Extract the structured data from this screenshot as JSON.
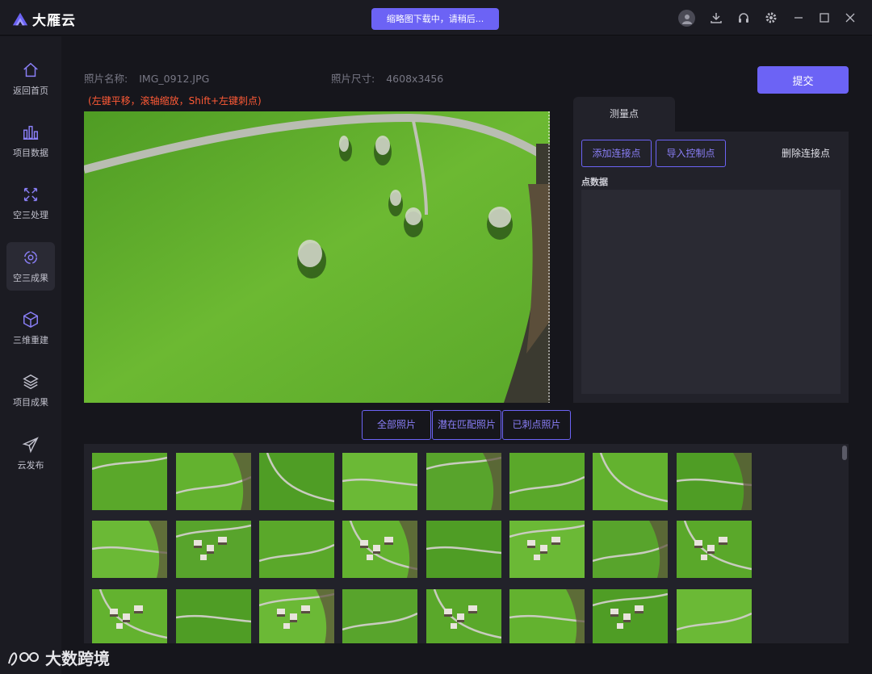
{
  "app": {
    "name": "大雁云",
    "toast": "缩略图下载中，请稍后..."
  },
  "sidebar": {
    "items": [
      {
        "label": "返回首页",
        "icon": "home-icon"
      },
      {
        "label": "项目数据",
        "icon": "bar-chart-icon"
      },
      {
        "label": "空三处理",
        "icon": "cross-arrows-icon"
      },
      {
        "label": "空三成果",
        "icon": "target-icon",
        "active": true
      },
      {
        "label": "三维重建",
        "icon": "cube-icon"
      },
      {
        "label": "项目成果",
        "icon": "layers-icon"
      },
      {
        "label": "云发布",
        "icon": "send-icon"
      }
    ]
  },
  "photo": {
    "name_label": "照片名称:",
    "name_value": "IMG_0912.JPG",
    "size_label": "照片尺寸:",
    "size_value": "4608x3456",
    "hint": "(左键平移，滚轴缩放，Shift+左键刺点)"
  },
  "submit_label": "提交",
  "panel": {
    "tab": "测量点",
    "add_tie": "添加连接点",
    "import_gcp": "导入控制点",
    "delete_tie": "删除连接点",
    "point_data_label": "点数据"
  },
  "filters": [
    "全部照片",
    "潜在匹配照片",
    "已刺点照片"
  ],
  "watermark": "大数跨境",
  "colors": {
    "accent": "#6c63f5",
    "hint": "#ff5a36"
  }
}
